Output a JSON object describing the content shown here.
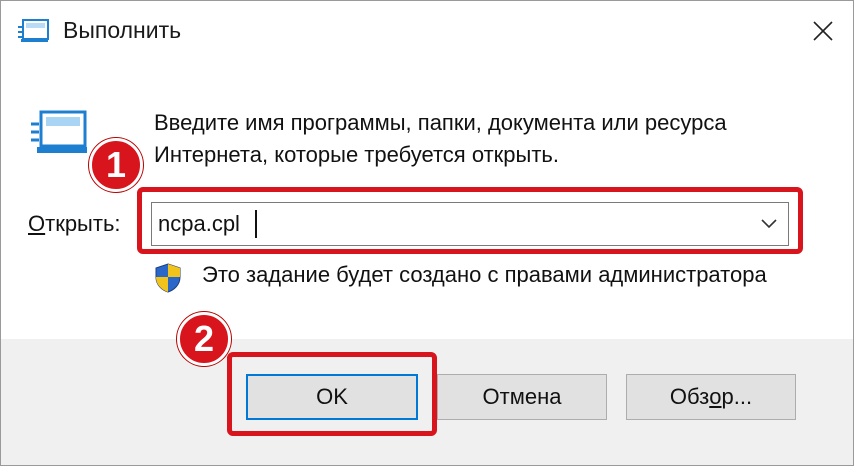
{
  "window": {
    "title": "Выполнить",
    "title_icon": "run-icon",
    "close_icon": "close-icon"
  },
  "main": {
    "description_line1": "Введите имя программы, папки, документа или ресурса",
    "description_line2": "Интернета, которые требуется открыть.",
    "open_label_accel": "О",
    "open_label_rest": "ткрыть:",
    "command_value": "ncpa.cpl",
    "admin_note": "Это задание будет создано с правами администратора",
    "shield_icon": "uac-shield-icon"
  },
  "buttons": {
    "ok": "OK",
    "cancel": "Отмена",
    "browse_pre": "Обз",
    "browse_accel": "о",
    "browse_post": "р..."
  },
  "annotations": {
    "step1": "1",
    "step2": "2",
    "highlight_color": "#d8141c"
  }
}
